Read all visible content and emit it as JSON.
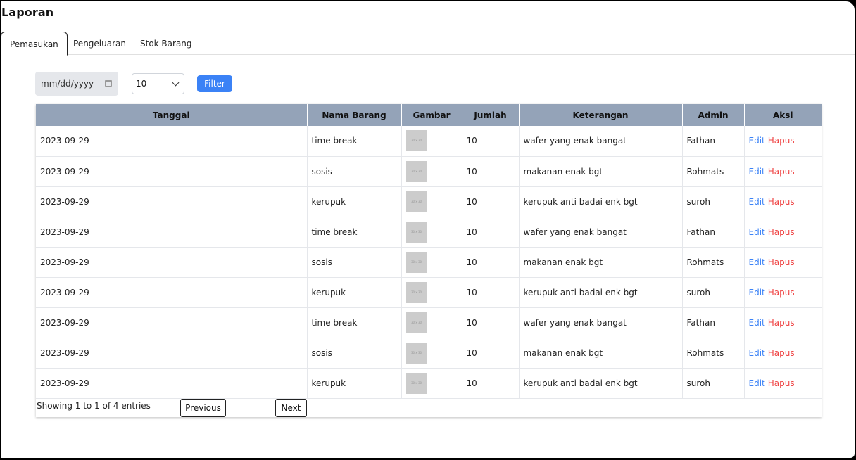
{
  "page_title": "Laporan",
  "tabs": [
    "Pemasukan",
    "Pengeluaran",
    "Stok Barang"
  ],
  "filter": {
    "date_placeholder": "mm/dd/yyyy",
    "page_size": "10",
    "button_label": "Filter"
  },
  "table": {
    "headers": [
      "Tanggal",
      "Nama Barang",
      "Gambar",
      "Jumlah",
      "Keterangan",
      "Admin",
      "Aksi"
    ],
    "thumb_text": "30 x 30",
    "edit_label": "Edit",
    "delete_label": "Hapus",
    "rows": [
      {
        "tanggal": "2023-09-29",
        "nama": "time break",
        "jumlah": "10",
        "keterangan": "wafer yang enak bangat",
        "admin": "Fathan"
      },
      {
        "tanggal": "2023-09-29",
        "nama": "sosis",
        "jumlah": "10",
        "keterangan": "makanan enak bgt",
        "admin": "Rohmats"
      },
      {
        "tanggal": "2023-09-29",
        "nama": "kerupuk",
        "jumlah": "10",
        "keterangan": "kerupuk anti badai enk bgt",
        "admin": "suroh"
      },
      {
        "tanggal": "2023-09-29",
        "nama": "time break",
        "jumlah": "10",
        "keterangan": "wafer yang enak bangat",
        "admin": "Fathan"
      },
      {
        "tanggal": "2023-09-29",
        "nama": "sosis",
        "jumlah": "10",
        "keterangan": "makanan enak bgt",
        "admin": "Rohmats"
      },
      {
        "tanggal": "2023-09-29",
        "nama": "kerupuk",
        "jumlah": "10",
        "keterangan": "kerupuk anti badai enk bgt",
        "admin": "suroh"
      },
      {
        "tanggal": "2023-09-29",
        "nama": "time break",
        "jumlah": "10",
        "keterangan": "wafer yang enak bangat",
        "admin": "Fathan"
      },
      {
        "tanggal": "2023-09-29",
        "nama": "sosis",
        "jumlah": "10",
        "keterangan": "makanan enak bgt",
        "admin": "Rohmats"
      },
      {
        "tanggal": "2023-09-29",
        "nama": "kerupuk",
        "jumlah": "10",
        "keterangan": "kerupuk anti badai enk bgt",
        "admin": "suroh"
      }
    ]
  },
  "pagination": {
    "info": "Showing 1 to 1 of 4 entries",
    "previous_label": "Previous",
    "next_label": "Next"
  },
  "colors": {
    "accent": "#3b82f6",
    "danger": "#ef4444",
    "table_header": "#94a3b8"
  }
}
